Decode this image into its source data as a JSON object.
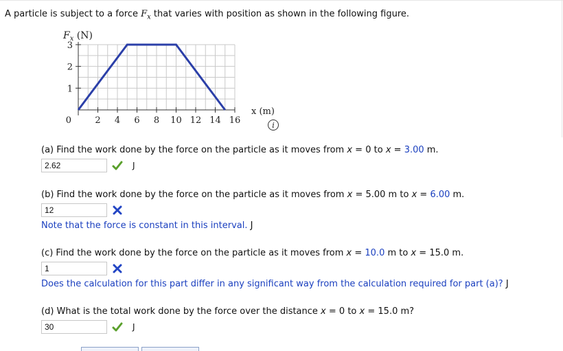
{
  "intro": {
    "before": "A particle is subject to a force ",
    "force_symbol": "F",
    "force_sub": "x",
    "after": " that varies with position as shown in the following figure."
  },
  "chart_data": {
    "type": "line",
    "ylabel_symbol": "F",
    "ylabel_sub": "x",
    "ylabel_unit": " (N)",
    "xlabel": "x (m)",
    "xlim": [
      0,
      16
    ],
    "ylim": [
      0,
      3
    ],
    "x_ticks": [
      2,
      4,
      6,
      8,
      10,
      12,
      14,
      16
    ],
    "y_ticks": [
      1,
      2,
      3
    ],
    "origin_label": "0",
    "grid": true,
    "series": [
      {
        "x": [
          0,
          5,
          10,
          15
        ],
        "y": [
          0,
          3,
          3,
          0
        ]
      }
    ],
    "line_color": "#2b3fa8"
  },
  "info_icon": "info-icon",
  "parts": {
    "a": {
      "pre": "(a) Find the work done by the force on the particle as it moves from ",
      "x1_var": "x",
      "eq1": " = ",
      "x1_val": "0",
      "mid": " to ",
      "x2_var": "x",
      "eq2": " = ",
      "x2_val": "3.00",
      "post": " m.",
      "answer": "2.62",
      "status": "correct",
      "unit": "J"
    },
    "b": {
      "pre": "(b) Find the work done by the force on the particle as it moves from ",
      "x1_var": "x",
      "eq1": " = ",
      "x1_val": "5.00 m",
      "mid": " to ",
      "x2_var": "x",
      "eq2": " = ",
      "x2_val": "6.00",
      "post": " m.",
      "answer": "12",
      "status": "incorrect",
      "note": "Note that the force is constant in this interval.",
      "unit": "J"
    },
    "c": {
      "pre": "(c) Find the work done by the force on the particle as it moves from ",
      "x1_var": "x",
      "eq1": " = ",
      "x1_val": "10.0",
      "mid": " m to ",
      "x2_var": "x",
      "eq2": " = ",
      "x2_val": "15.0 m.",
      "answer": "1",
      "status": "incorrect",
      "note": "Does the calculation for this part differ in any significant way from the calculation required for part (a)?",
      "unit": "J"
    },
    "d": {
      "pre": "(d) What is the total work done by the force over the distance ",
      "x1_var": "x",
      "eq1": " = ",
      "x1_val": "0",
      "mid": " to ",
      "x2_var": "x",
      "eq2": " = ",
      "x2_val": "15.0 m?",
      "answer": "30",
      "status": "correct",
      "unit": "J"
    }
  },
  "colors": {
    "correct": "#5aa02c",
    "incorrect": "#2245c4",
    "blue_text": "#1a3fbf"
  }
}
